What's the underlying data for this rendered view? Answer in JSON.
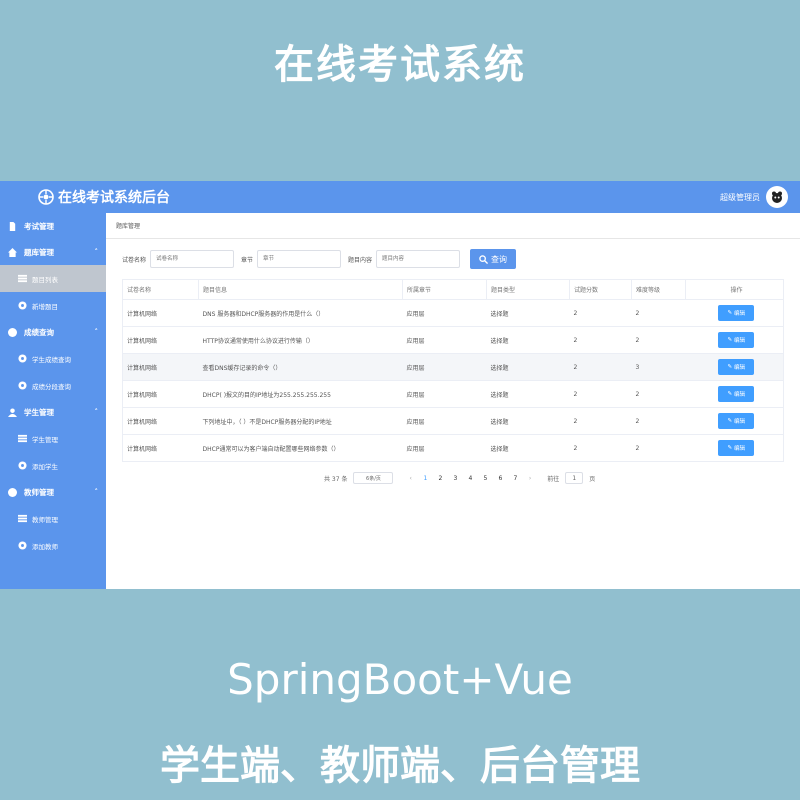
{
  "banner": {
    "title": "在线考试系统"
  },
  "topbar": {
    "app_title": "在线考试系统后台",
    "user_name": "超级管理员"
  },
  "sidebar": {
    "groups": [
      {
        "label": "考试管理",
        "items": []
      },
      {
        "label": "题库管理",
        "items": [
          {
            "label": "题目列表",
            "active": true
          },
          {
            "label": "新增题目"
          }
        ]
      },
      {
        "label": "成绩查询",
        "items": [
          {
            "label": "学生成绩查询"
          },
          {
            "label": "成绩分段查询"
          }
        ]
      },
      {
        "label": "学生管理",
        "items": [
          {
            "label": "学生管理"
          },
          {
            "label": "添加学生"
          }
        ]
      },
      {
        "label": "教师管理",
        "items": [
          {
            "label": "教师管理"
          },
          {
            "label": "添加教师"
          }
        ]
      }
    ]
  },
  "breadcrumb": {
    "label": "题库管理"
  },
  "filters": {
    "paper_label": "试卷名称",
    "paper_placeholder": "试卷名称",
    "chapter_label": "章节",
    "chapter_placeholder": "章节",
    "content_label": "题目内容",
    "content_placeholder": "题目内容",
    "search_label": "查询"
  },
  "table": {
    "headers": [
      "试卷名称",
      "题目信息",
      "所属章节",
      "题目类型",
      "试题分数",
      "难度等级",
      "操作"
    ],
    "edit_label": "编辑",
    "rows": [
      [
        "计算机网络",
        "DNS 服务器和DHCP服务器的作用是什么（）",
        "应用层",
        "选择题",
        "2",
        "2"
      ],
      [
        "计算机网络",
        "HTTP协议通常使用什么协议进行传输（）",
        "应用层",
        "选择题",
        "2",
        "2"
      ],
      [
        "计算机网络",
        "查看DNS缓存记录的命令（）",
        "应用层",
        "选择题",
        "2",
        "3"
      ],
      [
        "计算机网络",
        "DHCP( )报文的目的IP地址为255.255.255.255",
        "应用层",
        "选择题",
        "2",
        "2"
      ],
      [
        "计算机网络",
        "下列地址中，（ ）不是DHCP服务器分配的IP地址",
        "应用层",
        "选择题",
        "2",
        "2"
      ],
      [
        "计算机网络",
        "DHCP通常可以为客户端自动配置哪些网络参数（）",
        "应用层",
        "选择题",
        "2",
        "2"
      ]
    ]
  },
  "pagination": {
    "total": "共 37 条",
    "page_size": "6条/页",
    "pages": [
      "1",
      "2",
      "3",
      "4",
      "5",
      "6",
      "7"
    ],
    "current": "1",
    "goto_label": "前往",
    "goto_value": "1",
    "goto_suffix": "页"
  },
  "bottom": {
    "line1": "SpringBoot+Vue",
    "line2": "学生端、教师端、后台管理"
  }
}
